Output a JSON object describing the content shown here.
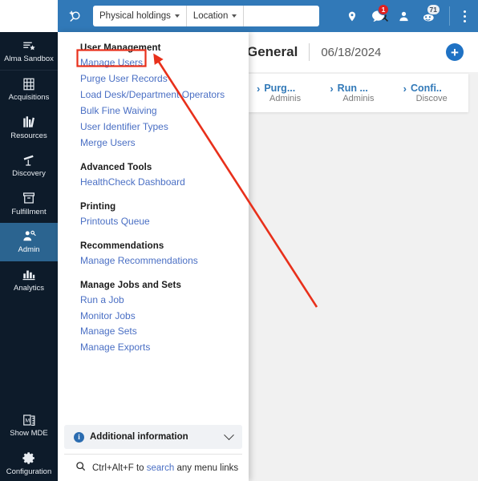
{
  "topbar": {
    "add_search_icon": "add-search-icon",
    "search": {
      "scope_label": "Physical holdings",
      "field_label": "Location",
      "value": "",
      "placeholder": "",
      "submit_icon": "search-icon"
    },
    "icons": [
      {
        "name": "location-pin-icon",
        "badge": ""
      },
      {
        "name": "chat-bubble-icon",
        "badge": "1"
      },
      {
        "name": "user-icon",
        "badge": ""
      },
      {
        "name": "tasks-icon",
        "badge": "71"
      }
    ],
    "menu_icon": "kebab-menu-icon"
  },
  "sidebar": {
    "items": [
      {
        "label": "Alma Sandbox",
        "icon": "alma-sandbox-icon",
        "active": false
      },
      {
        "label": "Acquisitions",
        "icon": "acquisitions-icon",
        "active": false
      },
      {
        "label": "Resources",
        "icon": "resources-icon",
        "active": false
      },
      {
        "label": "Discovery",
        "icon": "discovery-icon",
        "active": false
      },
      {
        "label": "Fulfillment",
        "icon": "fulfillment-icon",
        "active": false
      },
      {
        "label": "Admin",
        "icon": "admin-icon",
        "active": true
      },
      {
        "label": "Analytics",
        "icon": "analytics-icon",
        "active": false
      }
    ],
    "bottom_items": [
      {
        "label": "Show MDE",
        "icon": "show-mde-icon"
      },
      {
        "label": "Configuration",
        "icon": "gear-icon"
      }
    ]
  },
  "menu": {
    "groups": [
      {
        "heading": "User Management",
        "links": [
          {
            "label": "Manage Users",
            "highlighted": true
          },
          {
            "label": "Purge User Records",
            "highlighted": false
          },
          {
            "label": "Load Desk/Department Operators",
            "highlighted": false
          },
          {
            "label": "Bulk Fine Waiving",
            "highlighted": false
          },
          {
            "label": "User Identifier Types",
            "highlighted": false
          },
          {
            "label": "Merge Users",
            "highlighted": false
          }
        ]
      },
      {
        "heading": "Advanced Tools",
        "links": [
          {
            "label": "HealthCheck Dashboard",
            "highlighted": false
          }
        ]
      },
      {
        "heading": "Printing",
        "links": [
          {
            "label": "Printouts Queue",
            "highlighted": false
          }
        ]
      },
      {
        "heading": "Recommendations",
        "links": [
          {
            "label": "Manage Recommendations",
            "highlighted": false
          }
        ]
      },
      {
        "heading": "Manage Jobs and Sets",
        "links": [
          {
            "label": "Run a Job",
            "highlighted": false
          },
          {
            "label": "Monitor Jobs",
            "highlighted": false
          },
          {
            "label": "Manage Sets",
            "highlighted": false
          },
          {
            "label": "Manage Exports",
            "highlighted": false
          }
        ]
      }
    ],
    "additional_information": {
      "label": "Additional information",
      "info_icon": "info-icon",
      "expand_icon": "chevron-down-icon"
    },
    "footer": {
      "search_icon": "search-icon",
      "text_before": "Ctrl+Alt+F to ",
      "link_text": "search",
      "text_after": " any menu links"
    }
  },
  "content": {
    "page_title": "General",
    "page_date": "06/18/2024",
    "add_button_icon": "plus-circle-icon",
    "cards": [
      {
        "title": "Purg...",
        "subtitle": "Adminis"
      },
      {
        "title": "Run ...",
        "subtitle": "Adminis"
      },
      {
        "title": "Confi..",
        "subtitle": "Discove"
      }
    ]
  },
  "annotations": {
    "highlight_color": "#e8301b",
    "arrow_color": "#e8301b",
    "target_label": "Manage Users"
  }
}
